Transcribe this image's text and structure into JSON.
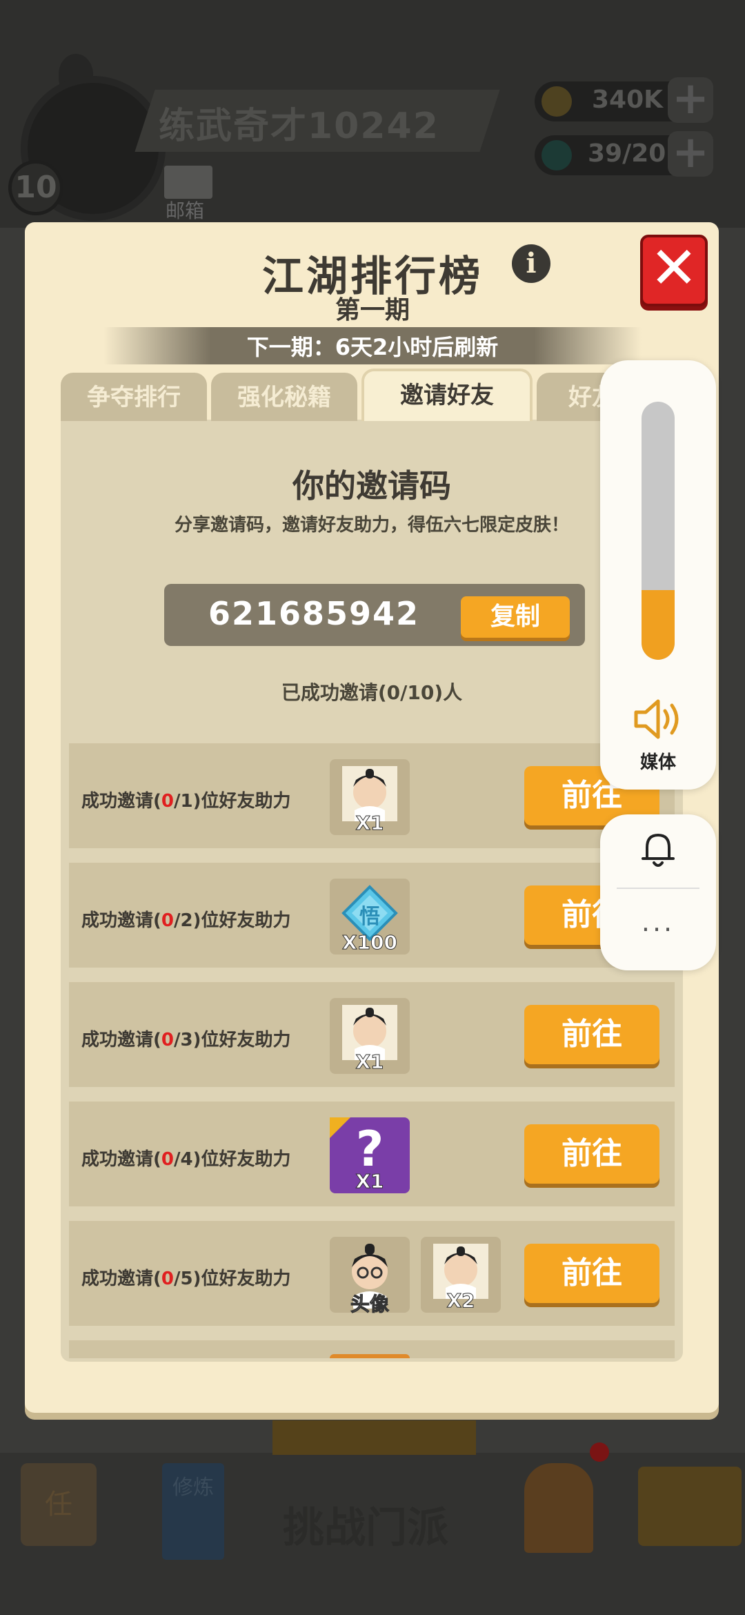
{
  "background": {
    "player_name": "练武奇才10242",
    "level": "10",
    "mail_label": "邮箱",
    "coins": "340K",
    "gems": "39/20",
    "bottom_nav": {
      "task": "任",
      "practice": "修炼",
      "challenge": "挑战门派"
    }
  },
  "modal": {
    "title": "江湖排行榜",
    "subtitle": "第一期",
    "refresh_notice": "下一期：6天2小时后刷新",
    "info_glyph": "i",
    "close_glyph": "✕"
  },
  "tabs": [
    {
      "label": "争夺排行",
      "active": false
    },
    {
      "label": "强化秘籍",
      "active": false
    },
    {
      "label": "邀请好友",
      "active": true
    },
    {
      "label": "好友",
      "active": false
    }
  ],
  "invite": {
    "heading": "你的邀请码",
    "description": "分享邀请码，邀请好友助力，得伍六七限定皮肤！",
    "code": "621685942",
    "copy_label": "复制",
    "invited_count": "已成功邀请(0/10)人"
  },
  "rewards": [
    {
      "prefix": "成功邀请(",
      "done": "0",
      "target": "/1)位好友助力",
      "items": [
        {
          "type": "character-fragment",
          "count": "X1"
        }
      ],
      "button": "前往"
    },
    {
      "prefix": "成功邀请(",
      "done": "0",
      "target": "/2)位好友助力",
      "items": [
        {
          "type": "skill-gem",
          "glyph": "悟",
          "count": "X100"
        }
      ],
      "button": "前往"
    },
    {
      "prefix": "成功邀请(",
      "done": "0",
      "target": "/3)位好友助力",
      "items": [
        {
          "type": "character-fragment",
          "count": "X1"
        }
      ],
      "button": "前往"
    },
    {
      "prefix": "成功邀请(",
      "done": "0",
      "target": "/4)位好友助力",
      "items": [
        {
          "type": "mystery-box",
          "glyph": "?",
          "count": "X1"
        }
      ],
      "button": "前往"
    },
    {
      "prefix": "成功邀请(",
      "done": "0",
      "target": "/5)位好友助力",
      "items": [
        {
          "type": "avatar-portrait",
          "count": "头像"
        },
        {
          "type": "character-fragment",
          "count": "X2"
        }
      ],
      "button": "前往"
    }
  ],
  "system_overlay": {
    "volume_level": 0.27,
    "media_label": "媒体",
    "more_glyph": "..."
  },
  "colors": {
    "accent_orange": "#f5a623",
    "modal_bg": "#f7ebcb",
    "close_red": "#e02626",
    "volume_fill": "#f0a020"
  }
}
